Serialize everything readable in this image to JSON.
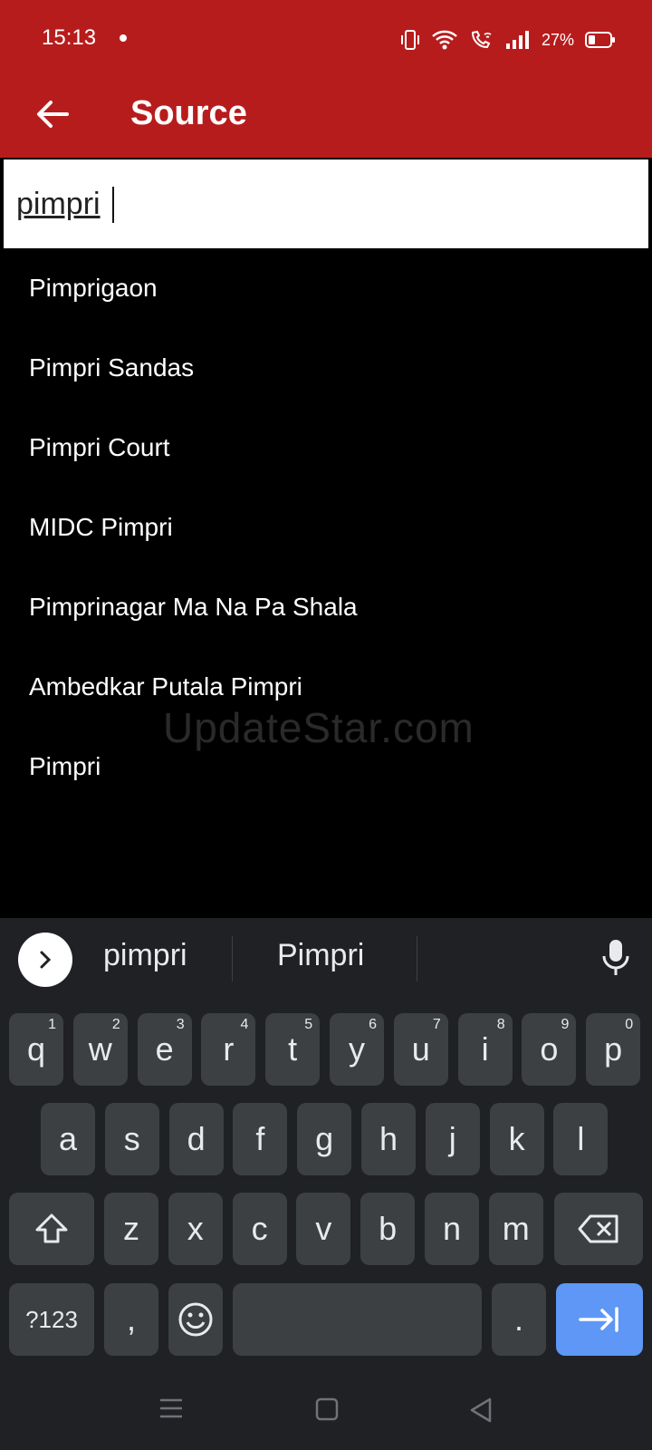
{
  "status_bar": {
    "time": "15:13",
    "battery_percent": "27%",
    "icons": [
      "vibrate-icon",
      "wifi-icon",
      "wifi-calling-icon",
      "signal-icon",
      "battery-icon"
    ]
  },
  "app_bar": {
    "title": "Source",
    "color": "#b71c1c"
  },
  "search": {
    "value": "pimpri"
  },
  "results": [
    "Pimprigaon",
    "Pimpri Sandas",
    "Pimpri Court",
    "MIDC Pimpri",
    "Pimprinagar Ma Na Pa Shala",
    "Ambedkar Putala Pimpri",
    "Pimpri"
  ],
  "watermark": "UpdateStar.com",
  "keyboard": {
    "suggestions": [
      "pimpri",
      "Pimpri"
    ],
    "row1": [
      {
        "k": "q",
        "h": "1"
      },
      {
        "k": "w",
        "h": "2"
      },
      {
        "k": "e",
        "h": "3"
      },
      {
        "k": "r",
        "h": "4"
      },
      {
        "k": "t",
        "h": "5"
      },
      {
        "k": "y",
        "h": "6"
      },
      {
        "k": "u",
        "h": "7"
      },
      {
        "k": "i",
        "h": "8"
      },
      {
        "k": "o",
        "h": "9"
      },
      {
        "k": "p",
        "h": "0"
      }
    ],
    "row2": [
      "a",
      "s",
      "d",
      "f",
      "g",
      "h",
      "j",
      "k",
      "l"
    ],
    "row3": [
      "z",
      "x",
      "c",
      "v",
      "b",
      "n",
      "m"
    ],
    "symbols_label": "?123",
    "comma_label": ",",
    "period_label": ".",
    "enter_color": "#5e97f6"
  }
}
